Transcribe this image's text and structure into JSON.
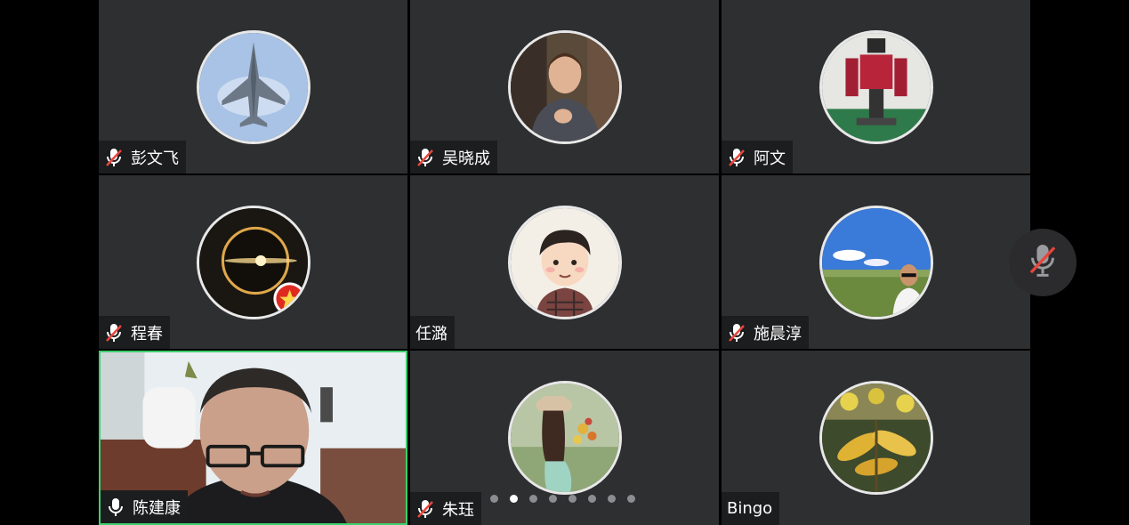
{
  "participants": [
    {
      "name": "彭文飞",
      "muted": true,
      "avatar": "fighter-jet-avatar"
    },
    {
      "name": "吴晓成",
      "muted": true,
      "avatar": "child-photo-avatar"
    },
    {
      "name": "阿文",
      "muted": true,
      "avatar": "robot-avatar"
    },
    {
      "name": "程春",
      "muted": true,
      "avatar": "eclipse-avatar"
    },
    {
      "name": "任潞",
      "muted": false,
      "avatar": "cartoon-boy-avatar"
    },
    {
      "name": "施晨淳",
      "muted": true,
      "avatar": "landscape-selfie-avatar"
    },
    {
      "name": "陈建康",
      "muted": false,
      "speaking": true,
      "avatar": "live-video"
    },
    {
      "name": "朱珏",
      "muted": true,
      "avatar": "girl-flowers-avatar"
    },
    {
      "name": "Bingo",
      "muted": false,
      "avatar": "yellow-leaves-avatar"
    }
  ],
  "pagination": {
    "total": 8,
    "current": 1
  },
  "controls": {
    "mic_state": "muted",
    "icon": "mic-off-icon"
  },
  "colors": {
    "tile": "#2e2f31",
    "nametag": "#1c1d1f",
    "active_border": "#3ecf6e",
    "muted_red": "#e8453c"
  }
}
